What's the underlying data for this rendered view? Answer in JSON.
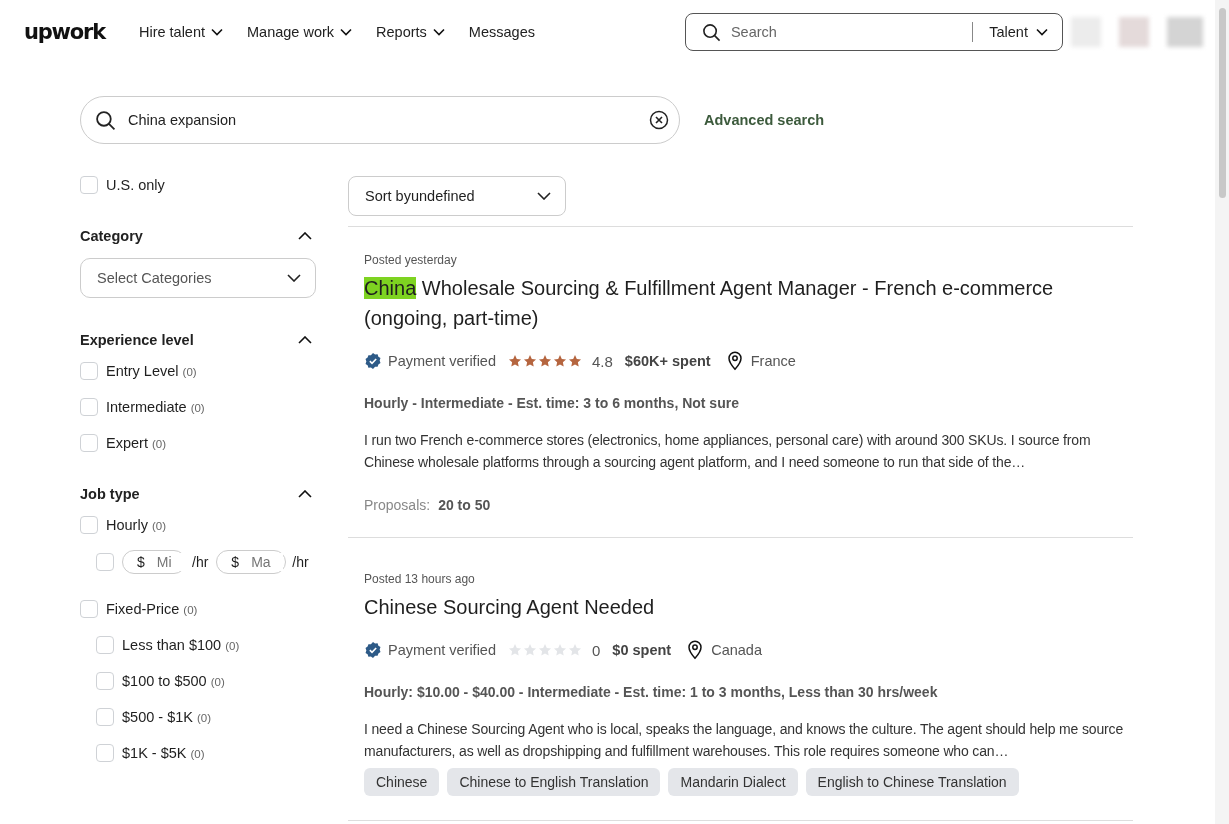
{
  "header": {
    "logo": "upwork",
    "nav": [
      {
        "label": "Hire talent",
        "dropdown": true
      },
      {
        "label": "Manage work",
        "dropdown": true
      },
      {
        "label": "Reports",
        "dropdown": true
      },
      {
        "label": "Messages",
        "dropdown": false
      }
    ],
    "search": {
      "placeholder": "Search",
      "scope": "Talent"
    }
  },
  "query": {
    "value": "China expansion",
    "advanced": "Advanced search"
  },
  "sidebar": {
    "us_only": {
      "label": "U.S. only",
      "checked": false
    },
    "sections": [
      {
        "kind": "select",
        "title": "Category",
        "expanded": true,
        "placeholder": "Select Categories"
      },
      {
        "kind": "checks",
        "title": "Experience level",
        "expanded": true,
        "options": [
          {
            "label": "Entry Level",
            "count": "(0)",
            "checked": false
          },
          {
            "label": "Intermediate",
            "count": "(0)",
            "checked": false
          },
          {
            "label": "Expert",
            "count": "(0)",
            "checked": false
          }
        ]
      },
      {
        "kind": "jobtype",
        "title": "Job type",
        "expanded": true,
        "hourly": {
          "label": "Hourly",
          "count": "(0)",
          "checked": false
        },
        "rate": {
          "checked": false,
          "currency_min": "$",
          "min_placeholder": "Mi",
          "unit_min": "/hr",
          "currency_max": "$",
          "max_placeholder": "Ma",
          "unit_max": "/hr"
        },
        "fixed": {
          "label": "Fixed-Price",
          "count": "(0)",
          "checked": false
        },
        "fixed_options": [
          {
            "label": "Less than $100",
            "count": "(0)",
            "checked": false
          },
          {
            "label": "$100 to $500",
            "count": "(0)",
            "checked": false
          },
          {
            "label": "$500 - $1K",
            "count": "(0)",
            "checked": false
          },
          {
            "label": "$1K - $5K",
            "count": "(0)",
            "checked": false
          }
        ]
      }
    ]
  },
  "sort": {
    "label": "Sort byundefined"
  },
  "jobs": [
    {
      "posted": "Posted yesterday",
      "title_parts": [
        {
          "text": "China",
          "highlighted": true
        },
        {
          "text": " Wholesale Sourcing & Fulfillment Agent Manager - French e-commerce (ongoing, part-time)",
          "highlighted": false
        }
      ],
      "payment": "Payment verified",
      "payment_verified": true,
      "stars": 5,
      "rating": "4.8",
      "spent": "$60K+ spent",
      "location": "France",
      "terms": "Hourly - Intermediate - Est. time: 3 to 6 months, Not sure",
      "description": "I run two French e-commerce stores (electronics, home appliances, personal care) with around 300 SKUs. I source from Chinese wholesale platforms through a sourcing agent platform, and I need someone to run that side of the…",
      "proposals_label": "Proposals:",
      "proposals": "20 to 50"
    },
    {
      "posted": "Posted 13 hours ago",
      "title_parts": [
        {
          "text": "Chinese Sourcing Agent Needed",
          "highlighted": false
        }
      ],
      "payment": "Payment verified",
      "payment_verified": true,
      "stars": 0,
      "rating": "0",
      "spent": "$0 spent",
      "location": "Canada",
      "terms": "Hourly: $10.00 - $40.00 - Intermediate - Est. time: 1 to 3 months, Less than 30 hrs/week",
      "description": "I need a Chinese Sourcing Agent who is local, speaks the language, and knows the culture. The agent should help me source manufacturers, as well as dropshipping and fulfillment warehouses. This role requires someone who can…",
      "skills": [
        "Chinese",
        "Chinese to English Translation",
        "Mandarin Dialect",
        "English to Chinese Translation"
      ]
    }
  ]
}
